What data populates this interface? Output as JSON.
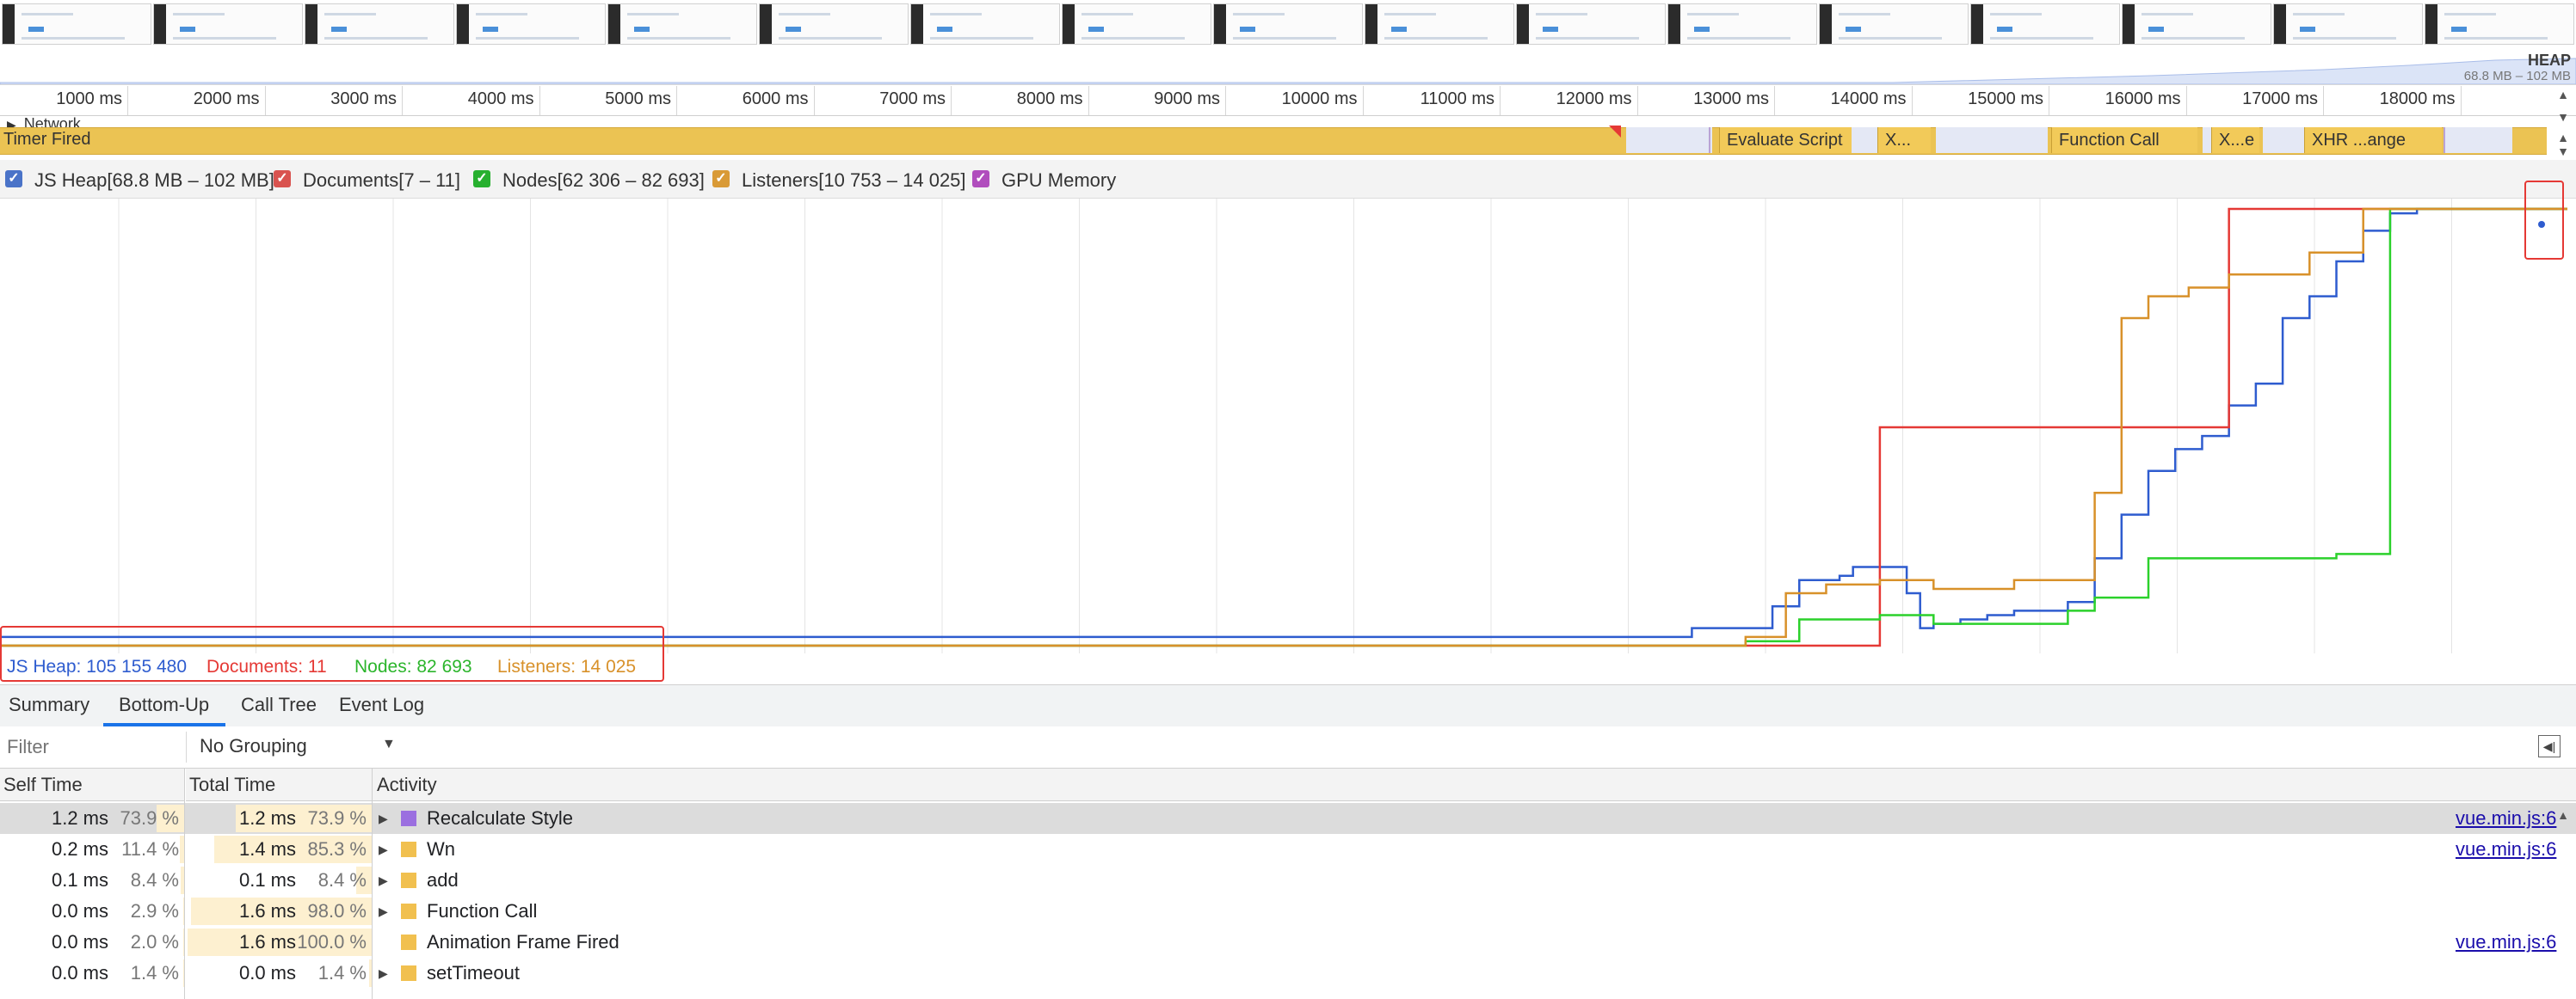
{
  "overview": {
    "heap_label": "HEAP",
    "heap_range": "68.8 MB – 102 MB"
  },
  "ruler": {
    "ticks": [
      "1000 ms",
      "2000 ms",
      "3000 ms",
      "4000 ms",
      "5000 ms",
      "6000 ms",
      "7000 ms",
      "8000 ms",
      "9000 ms",
      "10000 ms",
      "11000 ms",
      "12000 ms",
      "13000 ms",
      "14000 ms",
      "15000 ms",
      "16000 ms",
      "17000 ms",
      "18000 ms"
    ]
  },
  "tracks": {
    "network_label": "Network",
    "timer_label": "Timer Fired",
    "tasks": [
      "Evaluate Script",
      "X...",
      "Function Call",
      "X...e",
      "XHR ...ange"
    ]
  },
  "legend": {
    "items": [
      {
        "label": "JS Heap[68.8 MB – 102 MB]",
        "color": "#4a73c8"
      },
      {
        "label": "Documents[7 – 11]",
        "color": "#d9534f"
      },
      {
        "label": "Nodes[62 306 – 82 693]",
        "color": "#27b02f"
      },
      {
        "label": "Listeners[10 753 – 14 025]",
        "color": "#d99a36"
      },
      {
        "label": "GPU Memory",
        "color": "#b04dbd"
      }
    ]
  },
  "chart_data": {
    "type": "line",
    "x_unit": "ms",
    "series": [
      {
        "name": "JS Heap",
        "color": "#2e5ccf",
        "x": [
          0,
          12000,
          12600,
          13200,
          13400,
          13700,
          13800,
          14200,
          14300,
          14400,
          14600,
          14800,
          15000,
          15400,
          15600,
          15800,
          16000,
          16200,
          16400,
          16600,
          16800,
          17000,
          17200,
          17400,
          17600,
          17800,
          18000,
          18200
        ],
        "y": [
          0.02,
          0.02,
          0.04,
          0.09,
          0.15,
          0.16,
          0.18,
          0.12,
          0.04,
          0.05,
          0.06,
          0.07,
          0.08,
          0.1,
          0.2,
          0.3,
          0.4,
          0.45,
          0.48,
          0.55,
          0.6,
          0.75,
          0.8,
          0.88,
          0.95,
          0.99,
          1.0,
          1.0
        ]
      },
      {
        "name": "Documents",
        "color": "#e53935",
        "x": [
          0,
          14000,
          14000,
          16600,
          16600,
          18200
        ],
        "y": [
          0.0,
          0.0,
          0.5,
          0.5,
          1.0,
          1.0
        ]
      },
      {
        "name": "Nodes",
        "color": "#2bd12b",
        "x": [
          0,
          13000,
          13400,
          14000,
          14400,
          15000,
          15400,
          15600,
          16000,
          17400,
          17800,
          18200
        ],
        "y": [
          0.0,
          0.01,
          0.06,
          0.07,
          0.05,
          0.05,
          0.08,
          0.11,
          0.2,
          0.21,
          1.0,
          1.0
        ]
      },
      {
        "name": "Listeners",
        "color": "#d8912a",
        "x": [
          0,
          13000,
          13300,
          13600,
          14000,
          14400,
          15000,
          15600,
          15800,
          16000,
          16300,
          16600,
          17200,
          17600,
          18200
        ],
        "y": [
          0.0,
          0.02,
          0.12,
          0.14,
          0.15,
          0.13,
          0.15,
          0.35,
          0.75,
          0.8,
          0.82,
          0.85,
          0.9,
          1.0,
          1.0
        ]
      }
    ]
  },
  "readout": {
    "heap": "JS Heap: 105 155 480",
    "documents": "Documents: 11",
    "nodes": "Nodes: 82 693",
    "listeners": "Listeners: 14 025"
  },
  "tabs": [
    "Summary",
    "Bottom-Up",
    "Call Tree",
    "Event Log"
  ],
  "active_tab": "Bottom-Up",
  "filter": {
    "placeholder": "Filter",
    "grouping": "No Grouping"
  },
  "table": {
    "headers": [
      "Self Time",
      "Total Time",
      "Activity"
    ],
    "rows": [
      {
        "self": "1.2 ms",
        "self_pct": "73.9 %",
        "total": "1.2 ms",
        "total_pct": "73.9 %",
        "activity": "Recalculate Style",
        "color": "#9b6fe0",
        "expand": true,
        "link": "vue.min.js:6",
        "selected": true
      },
      {
        "self": "0.2 ms",
        "self_pct": "11.4 %",
        "total": "1.4 ms",
        "total_pct": "85.3 %",
        "activity": "Wn",
        "color": "#f1c04f",
        "expand": true,
        "link": "vue.min.js:6",
        "selected": false
      },
      {
        "self": "0.1 ms",
        "self_pct": "8.4 %",
        "total": "0.1 ms",
        "total_pct": "8.4 %",
        "activity": "add",
        "color": "#f1c04f",
        "expand": true,
        "link": "",
        "selected": false
      },
      {
        "self": "0.0 ms",
        "self_pct": "2.9 %",
        "total": "1.6 ms",
        "total_pct": "98.0 %",
        "activity": "Function Call",
        "color": "#f1c04f",
        "expand": true,
        "link": "",
        "selected": false
      },
      {
        "self": "0.0 ms",
        "self_pct": "2.0 %",
        "total": "1.6 ms",
        "total_pct": "100.0 %",
        "activity": "Animation Frame Fired",
        "color": "#f1c04f",
        "expand": false,
        "link": "vue.min.js:6",
        "selected": false
      },
      {
        "self": "0.0 ms",
        "self_pct": "1.4 %",
        "total": "0.0 ms",
        "total_pct": "1.4 %",
        "activity": "setTimeout",
        "color": "#f1c04f",
        "expand": true,
        "link": "",
        "selected": false
      }
    ]
  }
}
